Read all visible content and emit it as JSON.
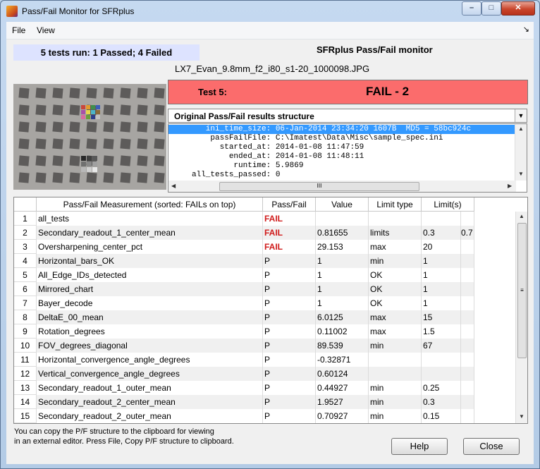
{
  "window": {
    "title": "Pass/Fail Monitor for SFRplus",
    "min": "–",
    "max": "□",
    "close": "✕"
  },
  "menu": {
    "items": [
      "File",
      "View"
    ],
    "arrow": "↘"
  },
  "summary": "5 tests run:  1 Passed;  4 Failed",
  "monitor_title": "SFRplus Pass/Fail monitor",
  "filename": "LX7_Evan_9.8mm_f2_i80_s1-20_1000098.JPG",
  "test": {
    "label": "Test 5:",
    "result": "FAIL - 2"
  },
  "struct": {
    "label": "Original Pass/Fail results structure",
    "lines": [
      "        ini_time_size: 06-Jan-2014 23:34:20 1607B  MD5 = 58bc924c",
      "         passFailFile: C:\\Imatest\\Data\\Misc\\sample_spec.ini",
      "           started_at: 2014-01-08 11:47:59",
      "             ended_at: 2014-01-08 11:48:11",
      "              runtime: 5.9869",
      "     all_tests_passed: 0"
    ],
    "scroll_grip": "III"
  },
  "table": {
    "headers": [
      "Pass/Fail Measurement  (sorted: FAILs on top)",
      "Pass/Fail",
      "Value",
      "Limit type",
      "Limit(s)"
    ],
    "rows": [
      {
        "n": "1",
        "name": "all_tests",
        "pf": "FAIL",
        "value": "",
        "ltype": "",
        "l1": "",
        "l2": ""
      },
      {
        "n": "2",
        "name": "Secondary_readout_1_center_mean",
        "pf": "FAIL",
        "value": "0.81655",
        "ltype": "limits",
        "l1": "0.3",
        "l2": "0.7"
      },
      {
        "n": "3",
        "name": "Oversharpening_center_pct",
        "pf": "FAIL",
        "value": "29.153",
        "ltype": "max",
        "l1": "20",
        "l2": ""
      },
      {
        "n": "4",
        "name": "Horizontal_bars_OK",
        "pf": "P",
        "value": "1",
        "ltype": "min",
        "l1": "1",
        "l2": ""
      },
      {
        "n": "5",
        "name": "All_Edge_IDs_detected",
        "pf": "P",
        "value": "1",
        "ltype": "OK",
        "l1": "1",
        "l2": ""
      },
      {
        "n": "6",
        "name": "Mirrored_chart",
        "pf": "P",
        "value": "1",
        "ltype": "OK",
        "l1": "1",
        "l2": ""
      },
      {
        "n": "7",
        "name": "Bayer_decode",
        "pf": "P",
        "value": "1",
        "ltype": "OK",
        "l1": "1",
        "l2": ""
      },
      {
        "n": "8",
        "name": "DeltaE_00_mean",
        "pf": "P",
        "value": "6.0125",
        "ltype": "max",
        "l1": "15",
        "l2": ""
      },
      {
        "n": "9",
        "name": "Rotation_degrees",
        "pf": "P",
        "value": "0.11002",
        "ltype": "max",
        "l1": "1.5",
        "l2": ""
      },
      {
        "n": "10",
        "name": "FOV_degrees_diagonal",
        "pf": "P",
        "value": "89.539",
        "ltype": "min",
        "l1": "67",
        "l2": ""
      },
      {
        "n": "11",
        "name": "Horizontal_convergence_angle_degrees",
        "pf": "P",
        "value": "-0.32871",
        "ltype": "",
        "l1": "",
        "l2": ""
      },
      {
        "n": "12",
        "name": "Vertical_convergence_angle_degrees",
        "pf": "P",
        "value": "0.60124",
        "ltype": "",
        "l1": "",
        "l2": ""
      },
      {
        "n": "13",
        "name": "Secondary_readout_1_outer_mean",
        "pf": "P",
        "value": "0.44927",
        "ltype": "min",
        "l1": "0.25",
        "l2": ""
      },
      {
        "n": "14",
        "name": "Secondary_readout_2_center_mean",
        "pf": "P",
        "value": "1.9527",
        "ltype": "min",
        "l1": "0.3",
        "l2": ""
      },
      {
        "n": "15",
        "name": "Secondary_readout_2_outer_mean",
        "pf": "P",
        "value": "0.70927",
        "ltype": "min",
        "l1": "0.15",
        "l2": ""
      }
    ],
    "scroll_grip": "≡"
  },
  "footer_note": [
    "You can copy the P/F structure to the clipboard for viewing",
    "in an external editor. Press File, Copy P/F structure to clipboard."
  ],
  "buttons": {
    "help": "Help",
    "close": "Close"
  },
  "colors": {
    "fail_bg": "#fb6c6c",
    "fail_text": "#d01c1c",
    "summary_bg": "#dde3ff",
    "selection": "#3399ff"
  }
}
